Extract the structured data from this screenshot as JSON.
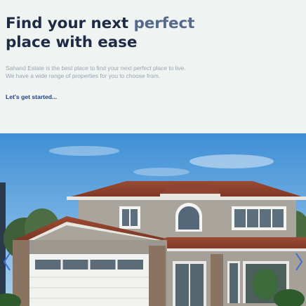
{
  "hero": {
    "headline_part1": "Find your next ",
    "headline_accent": "perfect",
    "headline_part2": "place with ease",
    "description_line1": "Sahand Estate is the best place to find your next perfect place to live.",
    "description_line2": "We have a wide range of properties for you to choose from.",
    "cta_label": "Let's get started..."
  },
  "carousel": {
    "image_subject": "house-photo",
    "prev_icon": "chevron-left-icon",
    "next_icon": "chevron-right-icon"
  },
  "colors": {
    "background": "#eff3f1",
    "headline": "#1f2a44",
    "headline_accent": "#56698a",
    "description": "#9aa5b1",
    "link": "#1f3f8a"
  }
}
